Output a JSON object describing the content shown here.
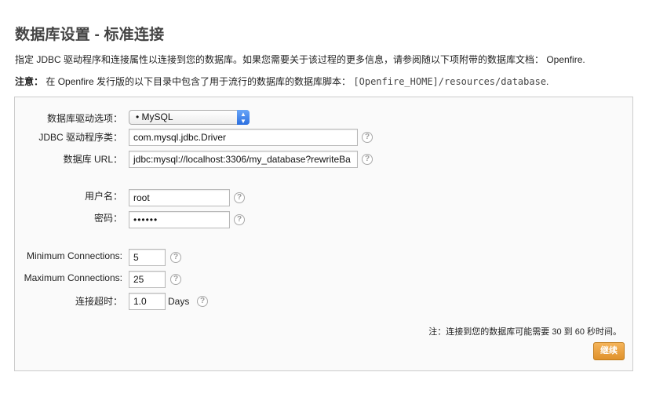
{
  "page": {
    "title": "数据库设置 - 标准连接",
    "intro": "指定 JDBC 驱动程序和连接属性以连接到您的数据库。如果您需要关于该过程的更多信息，请参阅随以下项附带的数据库文档： Openfire.",
    "note_label": "注意：",
    "note_text": "在 Openfire 发行版的以下目录中包含了用于流行的数据库的数据库脚本：",
    "note_path": "[Openfire_HOME]/resources/database",
    "note_end": "."
  },
  "form": {
    "driver_preset_label": "数据库驱动选项：",
    "driver_preset_value": "• MySQL",
    "jdbc_driver_label": "JDBC 驱动程序类：",
    "jdbc_driver_value": "com.mysql.jdbc.Driver",
    "db_url_label": "数据库 URL：",
    "db_url_value": "jdbc:mysql://localhost:3306/my_database?rewriteBa",
    "username_label": "用户名：",
    "username_value": "root",
    "password_label": "密码：",
    "password_value": "••••••",
    "min_conn_label": "Minimum Connections:",
    "min_conn_value": "5",
    "max_conn_label": "Maximum Connections:",
    "max_conn_value": "25",
    "timeout_label": "连接超时：",
    "timeout_value": "1.0",
    "timeout_unit": "Days",
    "help_glyph": "?",
    "footer_note": "注：连接到您的数据库可能需要 30 到 60 秒时间。",
    "continue_label": "继续"
  },
  "icons": {
    "help": "help-icon",
    "select_caret": "chevron-updown-icon"
  },
  "colors": {
    "button": "#e8a040",
    "select_caret": "#3b7ff0",
    "title": "#444444"
  }
}
